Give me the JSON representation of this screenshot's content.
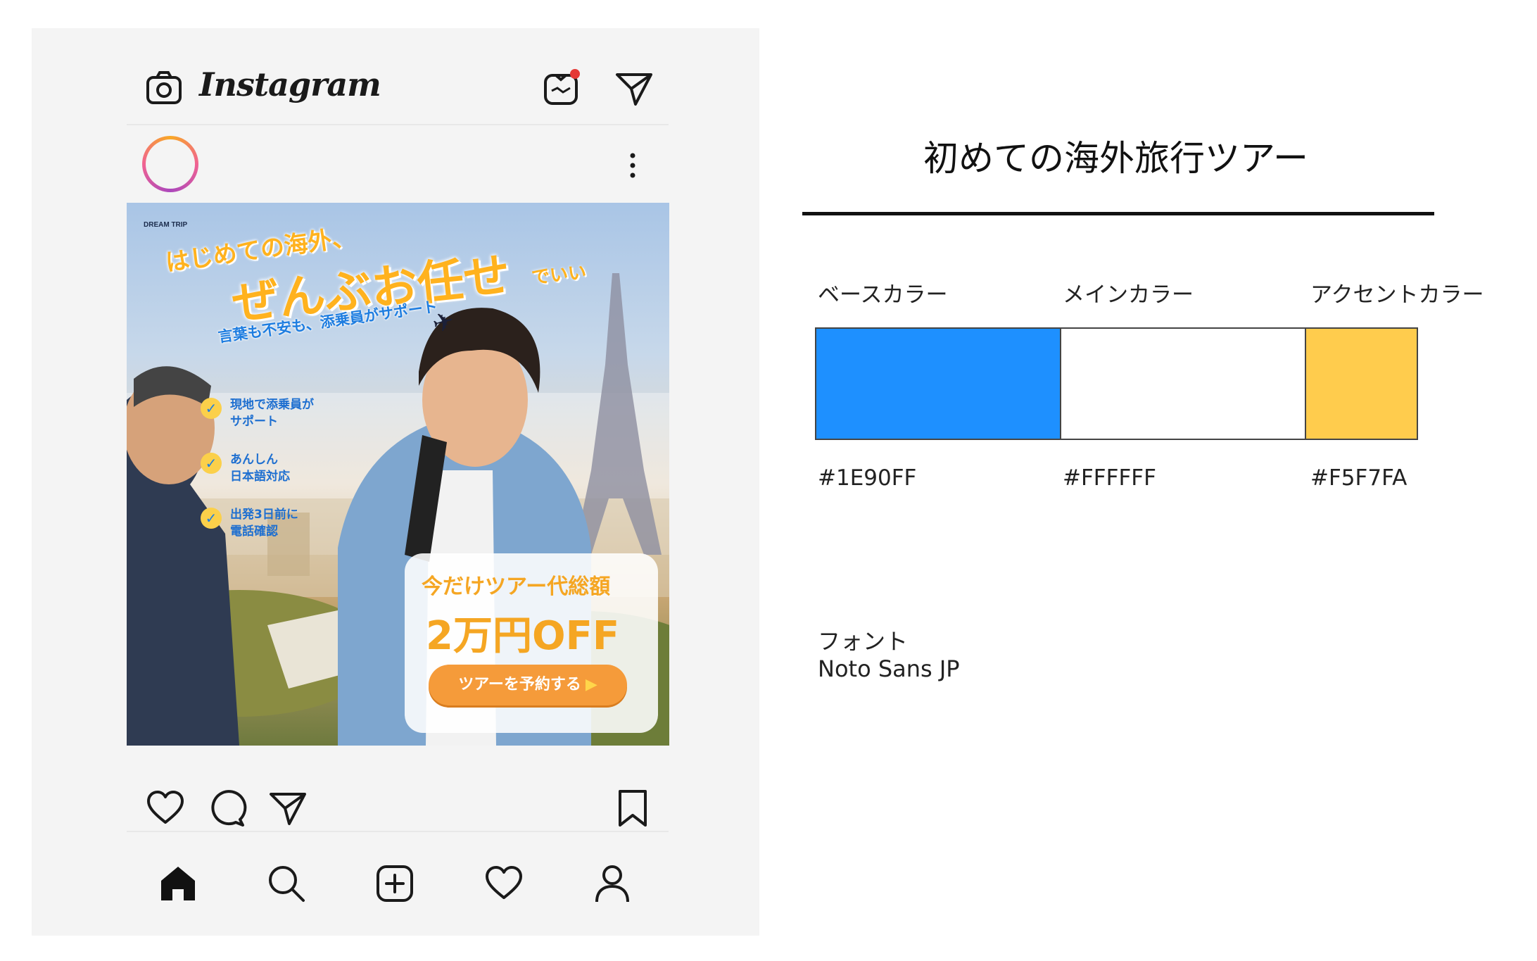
{
  "instagram": {
    "logo": "Instagram",
    "icons": [
      "camera-icon",
      "igtv-icon",
      "direct-message-icon",
      "more-options-icon",
      "like-icon",
      "comment-icon",
      "share-icon",
      "save-icon",
      "home-icon",
      "search-icon",
      "add-post-icon",
      "activity-icon",
      "profile-icon"
    ]
  },
  "ad": {
    "brand": "DREAM TRIP",
    "headline_1": "はじめての海外、",
    "headline_2": "ぜんぶお任せ",
    "headline_3": "でいい",
    "subline": "言葉も不安も、添乗員がサポート",
    "features": [
      {
        "line1": "現地で添乗員が",
        "line2": "サポート"
      },
      {
        "line1": "あんしん",
        "line2": "日本語対応"
      },
      {
        "line1": "出発3日前に",
        "line2": "電話確認"
      }
    ],
    "promo_line1": "今だけツアー代総額",
    "promo_line2": "2万円OFF",
    "cta": "ツアーを予約する",
    "cta_arrow": "▶",
    "colors": {
      "accent_orange": "#F5A623",
      "blue_text": "#1E7DE0",
      "check_yellow": "#FBD04A"
    }
  },
  "spec": {
    "title": "初めての海外旅行ツアー",
    "swatches": [
      {
        "label": "ベースカラー",
        "hex": "#1E90FF",
        "color": "#1E90FF"
      },
      {
        "label": "メインカラー",
        "hex": "#FFFFFF",
        "color": "#FFFFFF"
      },
      {
        "label": "アクセントカラー",
        "hex": "#F5F7FA",
        "color": "#FFCC4D"
      }
    ],
    "font_label": "フォント",
    "font_name": "Noto Sans JP"
  }
}
